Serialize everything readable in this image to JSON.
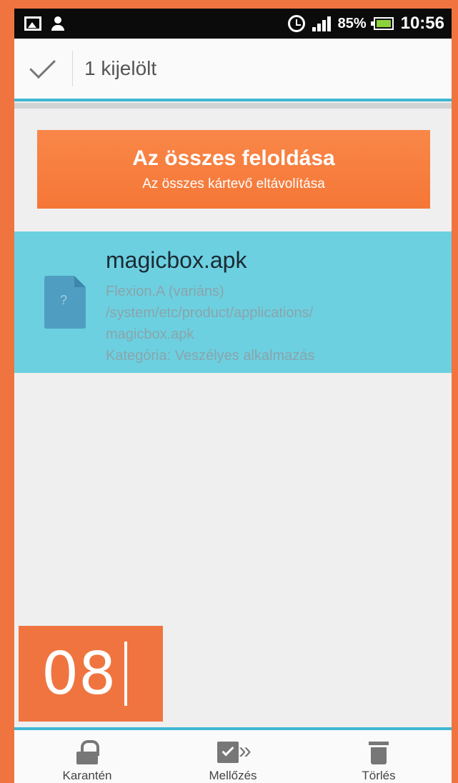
{
  "status_bar": {
    "battery_percent": "85%",
    "time": "10:56",
    "icons": [
      "image-icon",
      "person-icon",
      "alarm-icon",
      "signal-icon",
      "battery-icon"
    ]
  },
  "action_bar": {
    "selected_label": "1 kijelölt"
  },
  "unlock_button": {
    "title": "Az összes feloldása",
    "subtitle": "Az összes kártevő eltávolítása"
  },
  "threat": {
    "file_name": "magicbox.apk",
    "variant": "Flexion.A (variáns)",
    "path_line1": "/system/etc/product/applications/",
    "path_line2": "magicbox.apk",
    "category": "Kategória: Veszélyes alkalmazás"
  },
  "badge": {
    "number": "08"
  },
  "bottom_bar": {
    "items": [
      {
        "label": "Karantén",
        "icon": "lock-icon"
      },
      {
        "label": "Mellőzés",
        "icon": "ignore-icon"
      },
      {
        "label": "Törlés",
        "icon": "trash-icon"
      }
    ]
  },
  "colors": {
    "frame_orange": "#f07440",
    "button_orange": "#f57737",
    "highlight_blue": "#6cd0e0",
    "accent_cyan": "#3eb7d3"
  }
}
